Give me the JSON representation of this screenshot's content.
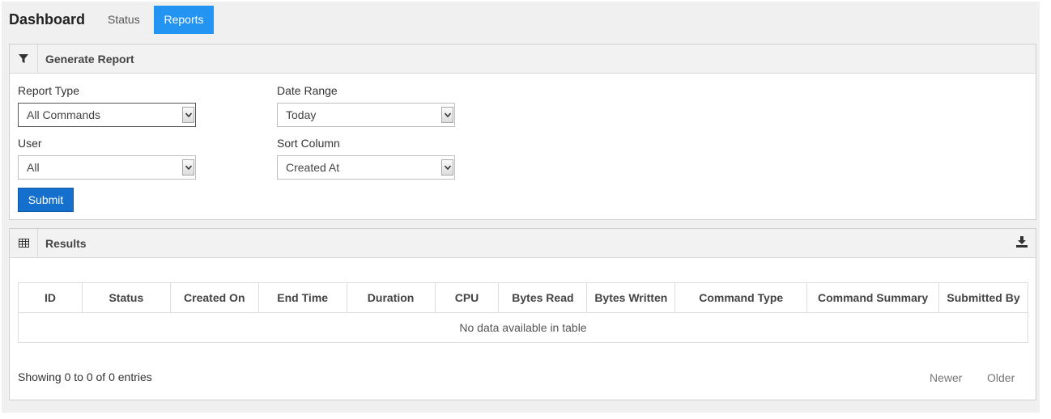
{
  "nav": {
    "brand": "Dashboard",
    "tabs": [
      {
        "label": "Status",
        "active": false
      },
      {
        "label": "Reports",
        "active": true
      }
    ],
    "active_color": "#2494f2"
  },
  "generate": {
    "title": "Generate Report",
    "icon": "filter-icon",
    "fields": {
      "report_type": {
        "label": "Report Type",
        "value": "All Commands"
      },
      "date_range": {
        "label": "Date Range",
        "value": "Today"
      },
      "user": {
        "label": "User",
        "value": "All"
      },
      "sort_column": {
        "label": "Sort Column",
        "value": "Created At"
      }
    },
    "submit_label": "Submit",
    "submit_color": "#1470cc"
  },
  "results": {
    "title": "Results",
    "icon": "table-icon",
    "download_icon": "download-icon",
    "columns": [
      "ID",
      "Status",
      "Created On",
      "End Time",
      "Duration",
      "CPU",
      "Bytes Read",
      "Bytes Written",
      "Command Type",
      "Command Summary",
      "Submitted By"
    ],
    "empty_message": "No data available in table",
    "info": "Showing 0 to 0 of 0 entries",
    "pager": {
      "newer": "Newer",
      "older": "Older"
    }
  }
}
